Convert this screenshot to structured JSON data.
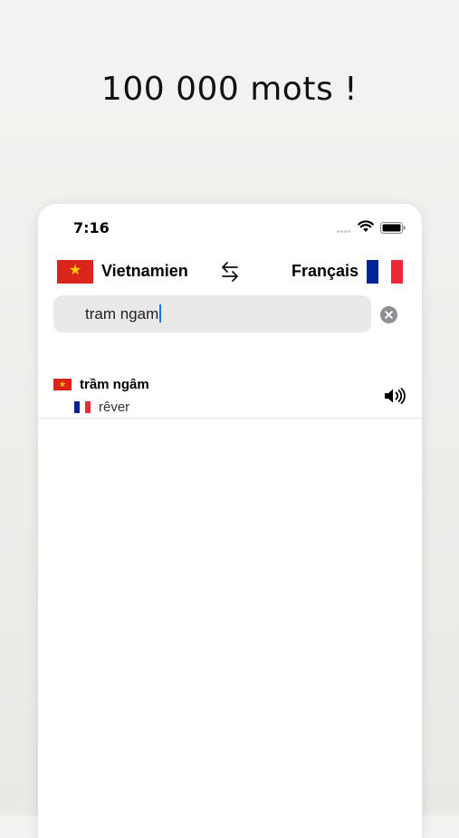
{
  "headline": "100 000 mots !",
  "status": {
    "time": "7:16"
  },
  "languages": {
    "source": "Vietnamien",
    "target": "Français",
    "swap_icon": "swap-arrows-icon"
  },
  "search": {
    "value": "tram ngam",
    "clear_icon": "clear-circle-icon"
  },
  "results": [
    {
      "word": "trầm ngâm",
      "translation": "rêver",
      "source_flag": "vietnam-flag-icon",
      "target_flag": "france-flag-icon",
      "audio_icon": "speaker-icon"
    }
  ],
  "colors": {
    "vn_red": "#da251d",
    "vn_star": "#ffcd00",
    "fr_blue": "#002395",
    "fr_red": "#ed2939",
    "caret": "#1a73e8"
  }
}
